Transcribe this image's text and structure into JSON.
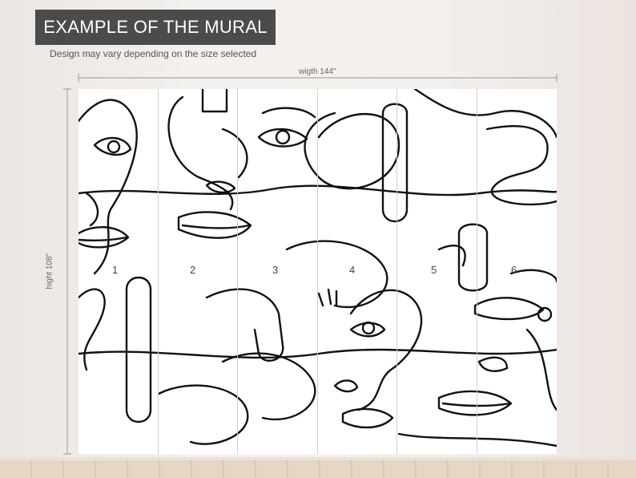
{
  "header": {
    "title": "EXAMPLE OF THE MURAL",
    "subtitle": "Design may vary depending on the size selected"
  },
  "dimensions": {
    "width_label": "wigth 144''",
    "height_label": "hight 108''"
  },
  "panels": [
    "1",
    "2",
    "3",
    "4",
    "5",
    "6"
  ],
  "colors": {
    "banner": "#4b4b4b",
    "wall": "#f1ece8",
    "line_art": "#111111"
  }
}
